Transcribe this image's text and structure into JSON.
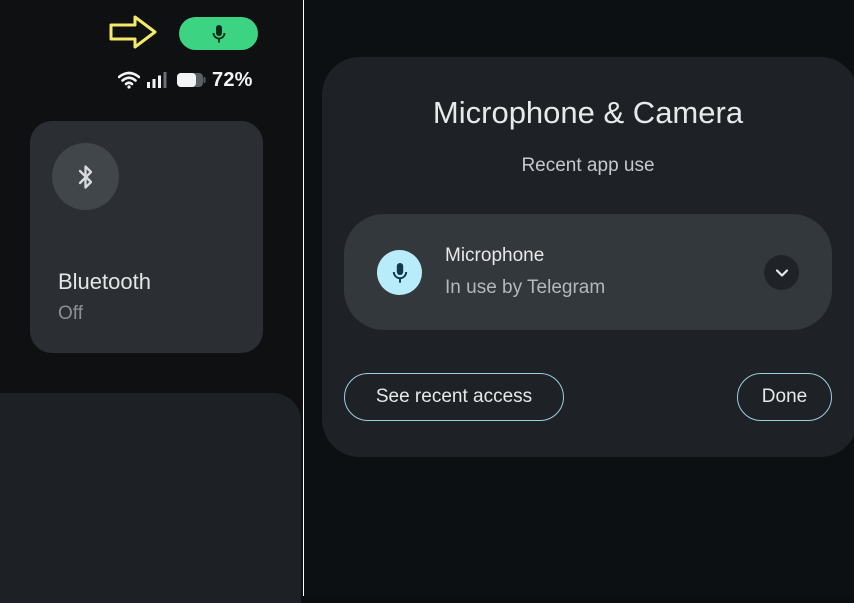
{
  "colors": {
    "mic_chip": "#3cd482",
    "arrow": "#f6e86a",
    "mic_icon_bg": "#b9ecfb",
    "button_border": "#9ad0dc"
  },
  "status_bar": {
    "mic_indicator_icon": "mic-icon",
    "wifi_icon": "wifi-icon",
    "signal_icon": "signal-icon",
    "battery_icon": "battery-icon",
    "battery_percent": "72%"
  },
  "quick_settings": {
    "bluetooth": {
      "icon": "bluetooth-icon",
      "label": "Bluetooth",
      "status": "Off"
    }
  },
  "dialog": {
    "title": "Microphone & Camera",
    "subtitle": "Recent app use",
    "item": {
      "icon": "mic-icon",
      "title": "Microphone",
      "subtitle": "In use by Telegram",
      "expand_icon": "chevron-down-icon"
    },
    "buttons": {
      "see_recent": "See recent access",
      "done": "Done"
    }
  }
}
